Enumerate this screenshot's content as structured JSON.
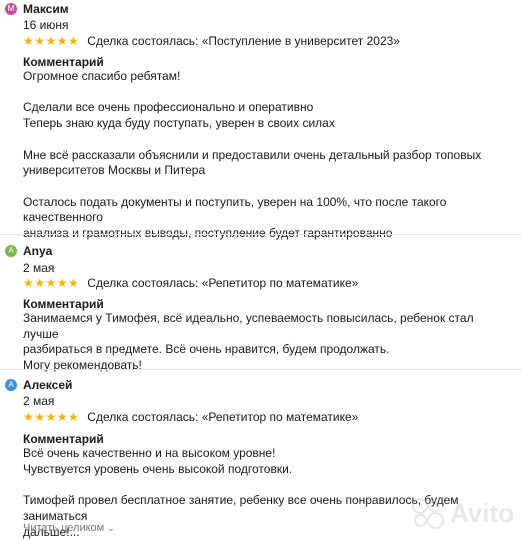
{
  "reviews": [
    {
      "avatar_letter": "М",
      "avatar_color": "#c74a9c",
      "name": "Максим",
      "date": "16 июня",
      "stars": "★★★★★",
      "deal": "Сделка состоялась: «Поступление в университет 2023»",
      "comment_heading": "Комментарий",
      "comment_text": "Огромное спасибо ребятам!\n\nСделали все очень профессионально и оперативно\nТеперь знаю куда буду поступать, уверен в своих силах\n\nМне всё рассказали объяснили и предоставили очень детальный разбор топовых\nуниверситетов Москвы и Питера\n\nОсталось подать документы и поступить, уверен на 100%, что после такого качественного\nанализа и грамотных выводы, поступление будет гарантированно"
    },
    {
      "avatar_letter": "A",
      "avatar_color": "#7ab648",
      "name": "Anya",
      "date": "2 мая",
      "stars": "★★★★★",
      "deal": "Сделка состоялась: «Репетитор по математике»",
      "comment_heading": "Комментарий",
      "comment_text": "Занимаемся у Тимофея, всё идеально, успеваемость повысилась, ребенок стал лучше\nразбираться в предмете. Всё очень нравится, будем продолжать.\nМогу рекомендовать!"
    },
    {
      "avatar_letter": "А",
      "avatar_color": "#3d8fe0",
      "name": "Алексей",
      "date": "2 мая",
      "stars": "★★★★★",
      "deal": "Сделка состоялась: «Репетитор по математике»",
      "comment_heading": "Комментарий",
      "comment_text": "Всё очень качественно и на высоком уровне!\nЧувствуется уровень очень высокой подготовки.\n\nТимофей провел бесплатное занятие, ребенку все очень понравилось, будем заниматься\nдальше!...",
      "read_more": "Читать целиком"
    }
  ],
  "watermark": "Avito"
}
